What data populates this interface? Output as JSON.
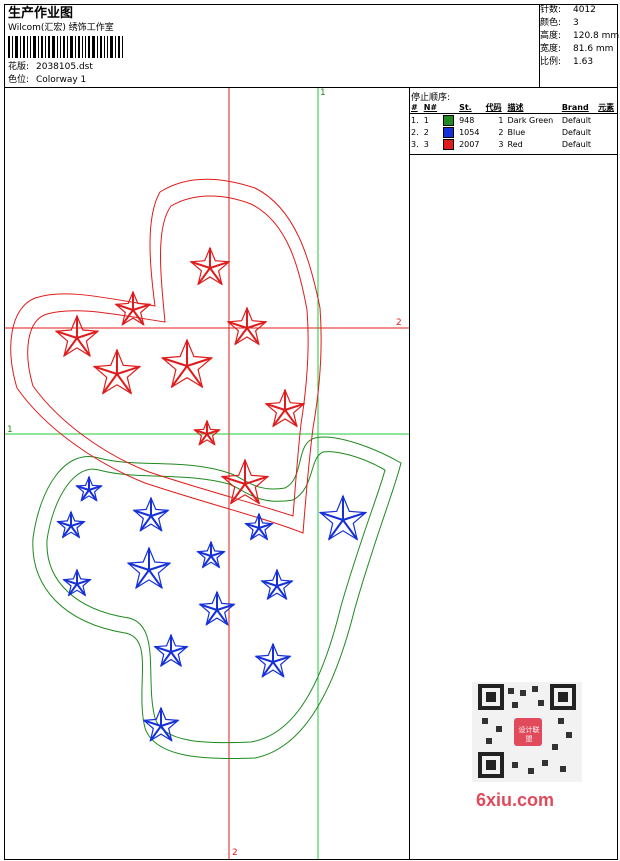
{
  "header": {
    "title": "生产作业图",
    "company": "Wilcom(汇宏) 绣饰工作室",
    "design_label": "花版:",
    "design_value": "2038105.dst",
    "colorway_label": "色位:",
    "colorway_value": "Colorway 1"
  },
  "stats": [
    {
      "label": "针数:",
      "value": "4012"
    },
    {
      "label": "颜色:",
      "value": "3"
    },
    {
      "label": "高度:",
      "value": "120.8 mm"
    },
    {
      "label": "宽度:",
      "value": "81.6 mm"
    },
    {
      "label": "比例:",
      "value": "1.63"
    }
  ],
  "stop_sequence": {
    "title": "停止顺序:",
    "headers": [
      "#",
      "N#",
      "St.",
      "代码",
      "描述",
      "Brand",
      "元素"
    ],
    "rows": [
      {
        "idx": "1.",
        "n": "1",
        "color": "#1f8a1f",
        "st": "948",
        "code": "1",
        "desc": "Dark Green",
        "brand": "Default"
      },
      {
        "idx": "2.",
        "n": "2",
        "color": "#1530d8",
        "st": "1054",
        "code": "2",
        "desc": "Blue",
        "brand": "Default"
      },
      {
        "idx": "3.",
        "n": "3",
        "color": "#e01b1b",
        "st": "2007",
        "code": "3",
        "desc": "Red",
        "brand": "Default"
      }
    ]
  },
  "axes": {
    "v1": "1",
    "h1": "1",
    "h2": "2",
    "v2": "2"
  },
  "watermark": "6xiu.com",
  "qr_badge": "设计联盟"
}
